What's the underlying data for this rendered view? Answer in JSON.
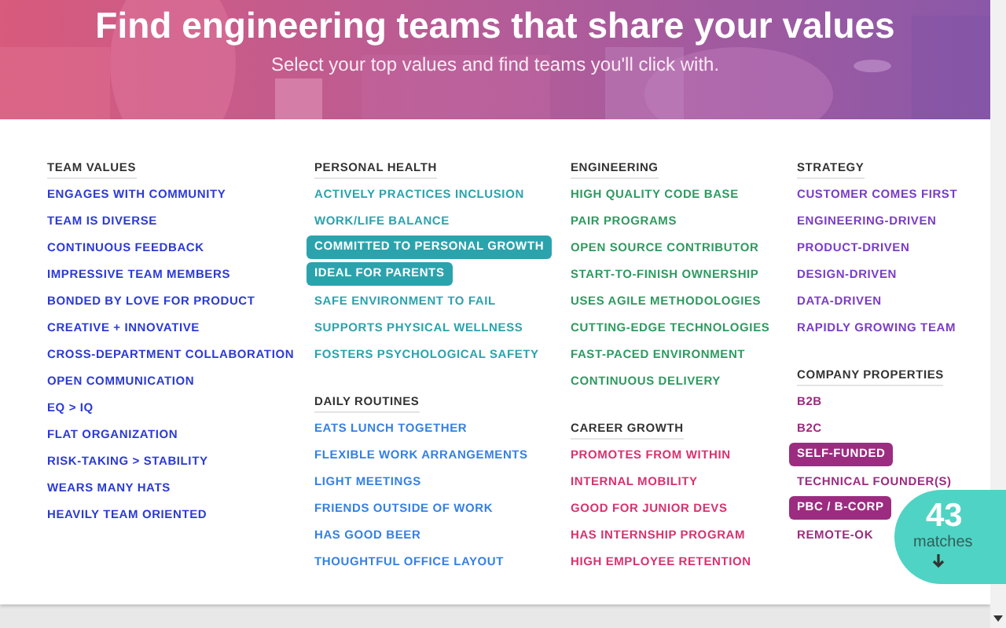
{
  "header": {
    "title": "Find engineering teams that share your values",
    "subtitle": "Select your top values and find teams you'll click with."
  },
  "columns": [
    {
      "sections": [
        {
          "heading": "TEAM VALUES",
          "color": "#2a3ad6",
          "items": [
            {
              "label": "ENGAGES WITH COMMUNITY",
              "selected": false
            },
            {
              "label": "TEAM IS DIVERSE",
              "selected": false
            },
            {
              "label": "CONTINUOUS FEEDBACK",
              "selected": false
            },
            {
              "label": "IMPRESSIVE TEAM MEMBERS",
              "selected": false
            },
            {
              "label": "BONDED BY LOVE FOR PRODUCT",
              "selected": false
            },
            {
              "label": "CREATIVE + INNOVATIVE",
              "selected": false
            },
            {
              "label": "CROSS-DEPARTMENT COLLABORATION",
              "selected": false
            },
            {
              "label": "OPEN COMMUNICATION",
              "selected": false
            },
            {
              "label": "EQ > IQ",
              "selected": false
            },
            {
              "label": "FLAT ORGANIZATION",
              "selected": false
            },
            {
              "label": "RISK-TAKING > STABILITY",
              "selected": false
            },
            {
              "label": "WEARS MANY HATS",
              "selected": false
            },
            {
              "label": "HEAVILY TEAM ORIENTED",
              "selected": false
            }
          ]
        }
      ]
    },
    {
      "sections": [
        {
          "heading": "PERSONAL HEALTH",
          "color": "#2ba3ad",
          "items": [
            {
              "label": "ACTIVELY PRACTICES INCLUSION",
              "selected": false
            },
            {
              "label": "WORK/LIFE BALANCE",
              "selected": false
            },
            {
              "label": "COMMITTED TO PERSONAL GROWTH",
              "selected": true
            },
            {
              "label": "IDEAL FOR PARENTS",
              "selected": true
            },
            {
              "label": "SAFE ENVIRONMENT TO FAIL",
              "selected": false
            },
            {
              "label": "SUPPORTS PHYSICAL WELLNESS",
              "selected": false
            },
            {
              "label": "FOSTERS PSYCHOLOGICAL SAFETY",
              "selected": false
            }
          ]
        },
        {
          "heading": "DAILY ROUTINES",
          "color": "#3580e6",
          "items": [
            {
              "label": "EATS LUNCH TOGETHER",
              "selected": false
            },
            {
              "label": "FLEXIBLE WORK ARRANGEMENTS",
              "selected": false
            },
            {
              "label": "LIGHT MEETINGS",
              "selected": false
            },
            {
              "label": "FRIENDS OUTSIDE OF WORK",
              "selected": false
            },
            {
              "label": "HAS GOOD BEER",
              "selected": false
            },
            {
              "label": "THOUGHTFUL OFFICE LAYOUT",
              "selected": false
            }
          ]
        }
      ]
    },
    {
      "sections": [
        {
          "heading": "ENGINEERING",
          "color": "#2e9a60",
          "items": [
            {
              "label": "HIGH QUALITY CODE BASE",
              "selected": false
            },
            {
              "label": "PAIR PROGRAMS",
              "selected": false
            },
            {
              "label": "OPEN SOURCE CONTRIBUTOR",
              "selected": false
            },
            {
              "label": "START-TO-FINISH OWNERSHIP",
              "selected": false
            },
            {
              "label": "USES AGILE METHODOLOGIES",
              "selected": false
            },
            {
              "label": "CUTTING-EDGE TECHNOLOGIES",
              "selected": false
            },
            {
              "label": "FAST-PACED ENVIRONMENT",
              "selected": false
            },
            {
              "label": "CONTINUOUS DELIVERY",
              "selected": false
            }
          ]
        },
        {
          "heading": "CAREER GROWTH",
          "color": "#d8326e",
          "items": [
            {
              "label": "PROMOTES FROM WITHIN",
              "selected": false
            },
            {
              "label": "INTERNAL MOBILITY",
              "selected": false
            },
            {
              "label": "GOOD FOR JUNIOR DEVS",
              "selected": false
            },
            {
              "label": "HAS INTERNSHIP PROGRAM",
              "selected": false
            },
            {
              "label": "HIGH EMPLOYEE RETENTION",
              "selected": false
            }
          ]
        }
      ]
    },
    {
      "sections": [
        {
          "heading": "STRATEGY",
          "color": "#7a3cc8",
          "items": [
            {
              "label": "CUSTOMER COMES FIRST",
              "selected": false
            },
            {
              "label": "ENGINEERING-DRIVEN",
              "selected": false
            },
            {
              "label": "PRODUCT-DRIVEN",
              "selected": false
            },
            {
              "label": "DESIGN-DRIVEN",
              "selected": false
            },
            {
              "label": "DATA-DRIVEN",
              "selected": false
            },
            {
              "label": "RAPIDLY GROWING TEAM",
              "selected": false
            }
          ]
        },
        {
          "heading": "COMPANY PROPERTIES",
          "color": "#9c2c80",
          "items": [
            {
              "label": "B2B",
              "selected": false
            },
            {
              "label": "B2C",
              "selected": false
            },
            {
              "label": "SELF-FUNDED",
              "selected": true
            },
            {
              "label": "TECHNICAL FOUNDER(S)",
              "selected": false
            },
            {
              "label": "PBC / B-CORP",
              "selected": true
            },
            {
              "label": "REMOTE-OK",
              "selected": false
            }
          ]
        }
      ]
    }
  ],
  "matches": {
    "count": "43",
    "label": "matches"
  }
}
